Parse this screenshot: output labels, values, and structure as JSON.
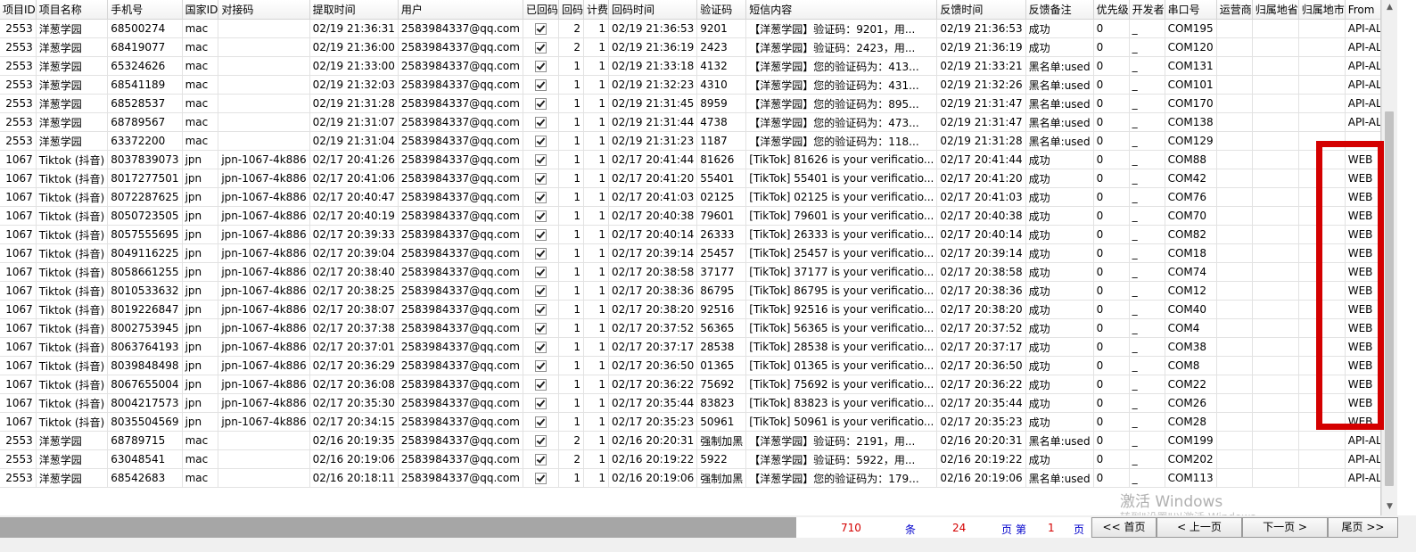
{
  "columns": [
    {
      "label": "项目ID",
      "width": 42
    },
    {
      "label": "项目名称",
      "width": 79
    },
    {
      "label": "手机号",
      "width": 78
    },
    {
      "label": "国家ID",
      "width": 45
    },
    {
      "label": "对接码",
      "width": 95
    },
    {
      "label": "提取时间",
      "width": 94
    },
    {
      "label": "用户",
      "width": 130
    },
    {
      "label": "已回码",
      "width": 46
    },
    {
      "label": "回码",
      "width": 33
    },
    {
      "label": "计费",
      "width": 33
    },
    {
      "label": "回码时间",
      "width": 95
    },
    {
      "label": "验证码",
      "width": 58
    },
    {
      "label": "短信内容",
      "width": 197
    },
    {
      "label": "反馈时间",
      "width": 95
    },
    {
      "label": "反馈备注",
      "width": 75
    },
    {
      "label": "优先级",
      "width": 45
    },
    {
      "label": "开发者",
      "width": 46
    },
    {
      "label": "串口号",
      "width": 54
    },
    {
      "label": "运营商",
      "width": 46
    },
    {
      "label": "归属地省",
      "width": 57
    },
    {
      "label": "归属地市",
      "width": 57
    },
    {
      "label": "From",
      "width": 48
    }
  ],
  "rows": [
    [
      "2553",
      "洋葱学园",
      "68500274",
      "mac",
      "",
      "02/19 21:36:31",
      "2583984337@qq.com",
      "checked",
      "2",
      "1",
      "02/19 21:36:53",
      "9201",
      "【洋葱学园】验证码：9201，用...",
      "02/19 21:36:53",
      "成功",
      "0",
      "_",
      "COM195",
      "",
      "",
      "",
      "API-ALL"
    ],
    [
      "2553",
      "洋葱学园",
      "68419077",
      "mac",
      "",
      "02/19 21:36:00",
      "2583984337@qq.com",
      "checked",
      "2",
      "1",
      "02/19 21:36:19",
      "2423",
      "【洋葱学园】验证码：2423，用...",
      "02/19 21:36:19",
      "成功",
      "0",
      "_",
      "COM120",
      "",
      "",
      "",
      "API-ALL"
    ],
    [
      "2553",
      "洋葱学园",
      "65324626",
      "mac",
      "",
      "02/19 21:33:00",
      "2583984337@qq.com",
      "checked",
      "1",
      "1",
      "02/19 21:33:18",
      "4132",
      "【洋葱学园】您的验证码为：413...",
      "02/19 21:33:21",
      "黑名单:used",
      "0",
      "_",
      "COM131",
      "",
      "",
      "",
      "API-ALL"
    ],
    [
      "2553",
      "洋葱学园",
      "68541189",
      "mac",
      "",
      "02/19 21:32:03",
      "2583984337@qq.com",
      "checked",
      "1",
      "1",
      "02/19 21:32:23",
      "4310",
      "【洋葱学园】您的验证码为：431...",
      "02/19 21:32:26",
      "黑名单:used",
      "0",
      "_",
      "COM101",
      "",
      "",
      "",
      "API-ALL"
    ],
    [
      "2553",
      "洋葱学园",
      "68528537",
      "mac",
      "",
      "02/19 21:31:28",
      "2583984337@qq.com",
      "checked",
      "1",
      "1",
      "02/19 21:31:45",
      "8959",
      "【洋葱学园】您的验证码为：895...",
      "02/19 21:31:47",
      "黑名单:used",
      "0",
      "_",
      "COM170",
      "",
      "",
      "",
      "API-ALL"
    ],
    [
      "2553",
      "洋葱学园",
      "68789567",
      "mac",
      "",
      "02/19 21:31:07",
      "2583984337@qq.com",
      "checked",
      "1",
      "1",
      "02/19 21:31:44",
      "4738",
      "【洋葱学园】您的验证码为：473...",
      "02/19 21:31:47",
      "黑名单:used",
      "0",
      "_",
      "COM138",
      "",
      "",
      "",
      "API-ALL"
    ],
    [
      "2553",
      "洋葱学园",
      "63372200",
      "mac",
      "",
      "02/19 21:31:04",
      "2583984337@qq.com",
      "checked",
      "1",
      "1",
      "02/19 21:31:23",
      "1187",
      "【洋葱学园】您的验证码为：118...",
      "02/19 21:31:28",
      "黑名单:used",
      "0",
      "_",
      "COM129",
      "",
      "",
      "",
      ""
    ],
    [
      "1067",
      "Tiktok (抖音)",
      "8037839073",
      "jpn",
      "jpn-1067-4k886",
      "02/17 20:41:26",
      "2583984337@qq.com",
      "checked",
      "1",
      "1",
      "02/17 20:41:44",
      "81626",
      "[TikTok] 81626 is your verificatio...",
      "02/17 20:41:44",
      "成功",
      "0",
      "_",
      "COM88",
      "",
      "",
      "",
      "WEB"
    ],
    [
      "1067",
      "Tiktok (抖音)",
      "8017277501",
      "jpn",
      "jpn-1067-4k886",
      "02/17 20:41:06",
      "2583984337@qq.com",
      "checked",
      "1",
      "1",
      "02/17 20:41:20",
      "55401",
      "[TikTok] 55401 is your verificatio...",
      "02/17 20:41:20",
      "成功",
      "0",
      "_",
      "COM42",
      "",
      "",
      "",
      "WEB"
    ],
    [
      "1067",
      "Tiktok (抖音)",
      "8072287625",
      "jpn",
      "jpn-1067-4k886",
      "02/17 20:40:47",
      "2583984337@qq.com",
      "checked",
      "1",
      "1",
      "02/17 20:41:03",
      "02125",
      "[TikTok] 02125 is your verificatio...",
      "02/17 20:41:03",
      "成功",
      "0",
      "_",
      "COM76",
      "",
      "",
      "",
      "WEB"
    ],
    [
      "1067",
      "Tiktok (抖音)",
      "8050723505",
      "jpn",
      "jpn-1067-4k886",
      "02/17 20:40:19",
      "2583984337@qq.com",
      "checked",
      "1",
      "1",
      "02/17 20:40:38",
      "79601",
      "[TikTok] 79601 is your verificatio...",
      "02/17 20:40:38",
      "成功",
      "0",
      "_",
      "COM70",
      "",
      "",
      "",
      "WEB"
    ],
    [
      "1067",
      "Tiktok (抖音)",
      "8057555695",
      "jpn",
      "jpn-1067-4k886",
      "02/17 20:39:33",
      "2583984337@qq.com",
      "checked",
      "1",
      "1",
      "02/17 20:40:14",
      "26333",
      "[TikTok] 26333 is your verificatio...",
      "02/17 20:40:14",
      "成功",
      "0",
      "_",
      "COM82",
      "",
      "",
      "",
      "WEB"
    ],
    [
      "1067",
      "Tiktok (抖音)",
      "8049116225",
      "jpn",
      "jpn-1067-4k886",
      "02/17 20:39:04",
      "2583984337@qq.com",
      "checked",
      "1",
      "1",
      "02/17 20:39:14",
      "25457",
      "[TikTok] 25457 is your verificatio...",
      "02/17 20:39:14",
      "成功",
      "0",
      "_",
      "COM18",
      "",
      "",
      "",
      "WEB"
    ],
    [
      "1067",
      "Tiktok (抖音)",
      "8058661255",
      "jpn",
      "jpn-1067-4k886",
      "02/17 20:38:40",
      "2583984337@qq.com",
      "checked",
      "1",
      "1",
      "02/17 20:38:58",
      "37177",
      "[TikTok] 37177 is your verificatio...",
      "02/17 20:38:58",
      "成功",
      "0",
      "_",
      "COM74",
      "",
      "",
      "",
      "WEB"
    ],
    [
      "1067",
      "Tiktok (抖音)",
      "8010533632",
      "jpn",
      "jpn-1067-4k886",
      "02/17 20:38:25",
      "2583984337@qq.com",
      "checked",
      "1",
      "1",
      "02/17 20:38:36",
      "86795",
      "[TikTok] 86795 is your verificatio...",
      "02/17 20:38:36",
      "成功",
      "0",
      "_",
      "COM12",
      "",
      "",
      "",
      "WEB"
    ],
    [
      "1067",
      "Tiktok (抖音)",
      "8019226847",
      "jpn",
      "jpn-1067-4k886",
      "02/17 20:38:07",
      "2583984337@qq.com",
      "checked",
      "1",
      "1",
      "02/17 20:38:20",
      "92516",
      "[TikTok] 92516 is your verificatio...",
      "02/17 20:38:20",
      "成功",
      "0",
      "_",
      "COM40",
      "",
      "",
      "",
      "WEB"
    ],
    [
      "1067",
      "Tiktok (抖音)",
      "8002753945",
      "jpn",
      "jpn-1067-4k886",
      "02/17 20:37:38",
      "2583984337@qq.com",
      "checked",
      "1",
      "1",
      "02/17 20:37:52",
      "56365",
      "[TikTok] 56365 is your verificatio...",
      "02/17 20:37:52",
      "成功",
      "0",
      "_",
      "COM4",
      "",
      "",
      "",
      "WEB"
    ],
    [
      "1067",
      "Tiktok (抖音)",
      "8063764193",
      "jpn",
      "jpn-1067-4k886",
      "02/17 20:37:01",
      "2583984337@qq.com",
      "checked",
      "1",
      "1",
      "02/17 20:37:17",
      "28538",
      "[TikTok] 28538 is your verificatio...",
      "02/17 20:37:17",
      "成功",
      "0",
      "_",
      "COM38",
      "",
      "",
      "",
      "WEB"
    ],
    [
      "1067",
      "Tiktok (抖音)",
      "8039848498",
      "jpn",
      "jpn-1067-4k886",
      "02/17 20:36:29",
      "2583984337@qq.com",
      "checked",
      "1",
      "1",
      "02/17 20:36:50",
      "01365",
      "[TikTok] 01365 is your verificatio...",
      "02/17 20:36:50",
      "成功",
      "0",
      "_",
      "COM8",
      "",
      "",
      "",
      "WEB"
    ],
    [
      "1067",
      "Tiktok (抖音)",
      "8067655004",
      "jpn",
      "jpn-1067-4k886",
      "02/17 20:36:08",
      "2583984337@qq.com",
      "checked",
      "1",
      "1",
      "02/17 20:36:22",
      "75692",
      "[TikTok] 75692 is your verificatio...",
      "02/17 20:36:22",
      "成功",
      "0",
      "_",
      "COM22",
      "",
      "",
      "",
      "WEB"
    ],
    [
      "1067",
      "Tiktok (抖音)",
      "8004217573",
      "jpn",
      "jpn-1067-4k886",
      "02/17 20:35:30",
      "2583984337@qq.com",
      "checked",
      "1",
      "1",
      "02/17 20:35:44",
      "83823",
      "[TikTok] 83823 is your verificatio...",
      "02/17 20:35:44",
      "成功",
      "0",
      "_",
      "COM26",
      "",
      "",
      "",
      "WEB"
    ],
    [
      "1067",
      "Tiktok (抖音)",
      "8035504569",
      "jpn",
      "jpn-1067-4k886",
      "02/17 20:34:15",
      "2583984337@qq.com",
      "checked",
      "1",
      "1",
      "02/17 20:35:23",
      "50961",
      "[TikTok] 50961 is your verificatio...",
      "02/17 20:35:23",
      "成功",
      "0",
      "_",
      "COM28",
      "",
      "",
      "",
      "WEB"
    ],
    [
      "2553",
      "洋葱学园",
      "68789715",
      "mac",
      "",
      "02/16 20:19:35",
      "2583984337@qq.com",
      "checked",
      "2",
      "1",
      "02/16 20:20:31",
      "强制加黑",
      "【洋葱学园】验证码：2191，用...",
      "02/16 20:20:31",
      "黑名单:used",
      "0",
      "_",
      "COM199",
      "",
      "",
      "",
      "API-ALL"
    ],
    [
      "2553",
      "洋葱学园",
      "63048541",
      "mac",
      "",
      "02/16 20:19:06",
      "2583984337@qq.com",
      "checked",
      "2",
      "1",
      "02/16 20:19:22",
      "5922",
      "【洋葱学园】验证码：5922，用...",
      "02/16 20:19:22",
      "成功",
      "0",
      "_",
      "COM202",
      "",
      "",
      "",
      "API-ALL"
    ],
    [
      "2553",
      "洋葱学园",
      "68542683",
      "mac",
      "",
      "02/16 20:18:11",
      "2583984337@qq.com",
      "checked",
      "1",
      "1",
      "02/16 20:19:06",
      "强制加黑",
      "【洋葱学园】您的验证码为：179...",
      "02/16 20:19:06",
      "黑名单:used",
      "0",
      "_",
      "COM113",
      "",
      "",
      "",
      "API-ALL"
    ]
  ],
  "pager": {
    "total_count": "710",
    "count_unit": "条",
    "total_pages": "24",
    "pages_unit": "页",
    "page_prefix": "第",
    "current_page": "1",
    "page_suffix": "页",
    "first_label": "<< 首页",
    "prev_label": "< 上一页",
    "next_label": "下一页 >",
    "last_label": "尾页 >>",
    "count_color": "#d40000",
    "label_color": "#0000cc"
  },
  "watermark": {
    "title": "激活 Windows",
    "subtitle": "转到\"设置\"以激活 Windows。"
  },
  "highlight_color": "#d40000"
}
